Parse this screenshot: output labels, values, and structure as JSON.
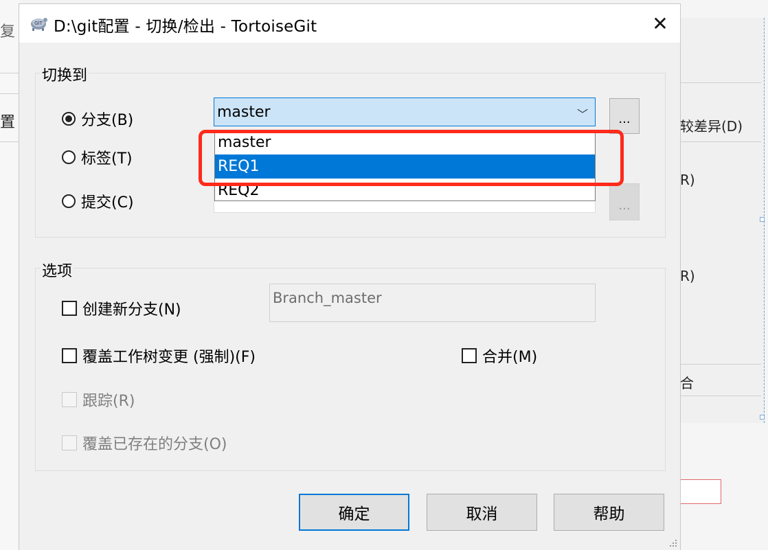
{
  "background": {
    "left_fragments": [
      "复",
      "置"
    ],
    "right_fragments": [
      "较差异(D)",
      "R)",
      "R)",
      "合"
    ]
  },
  "dialog": {
    "title": "D:\\git配置 - 切换/检出 - TortoiseGit",
    "close_glyph": "✕",
    "switch_to": {
      "label": "切换到",
      "radio_branch": "分支(B)",
      "radio_tag": "标签(T)",
      "radio_commit": "提交(C)",
      "selected": "branch",
      "branch_value": "master",
      "browse_label": "...",
      "dropdown_options": [
        "master",
        "REQ1",
        "REQ2"
      ],
      "highlighted_option": "REQ1"
    },
    "options": {
      "label": "选项",
      "create_branch": "创建新分支(N)",
      "new_branch_name": "Branch_master",
      "force_overwrite": "覆盖工作树变更 (强制)(F)",
      "merge": "合并(M)",
      "track": "跟踪(R)",
      "override_existing": "覆盖已存在的分支(O)"
    },
    "buttons": {
      "ok": "确定",
      "cancel": "取消",
      "help": "帮助"
    }
  },
  "colors": {
    "selection": "#0078d7",
    "annotation": "#ff2a1a"
  }
}
